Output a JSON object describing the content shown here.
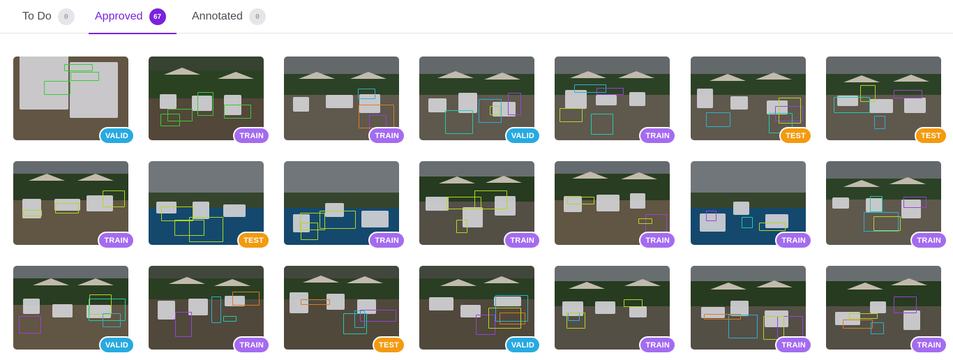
{
  "tabs": [
    {
      "label": "To Do",
      "count": "0",
      "active": false
    },
    {
      "label": "Approved",
      "count": "67",
      "active": true
    },
    {
      "label": "Annotated",
      "count": "0",
      "active": false
    }
  ],
  "split_colors": {
    "VALID": "#27aae1",
    "TRAIN": "#a46bf0",
    "TEST": "#f39a0f"
  },
  "box_colors": {
    "green": "#3ee53e",
    "lime": "#c9f026",
    "cyan": "#35c4e8",
    "purple": "#a84cf0",
    "orange": "#f28c28",
    "teal": "#28e3c0"
  },
  "images": [
    {
      "split": "VALID",
      "scene": "closeup",
      "boxes": [
        "green",
        "green",
        "green"
      ]
    },
    {
      "split": "TRAIN",
      "scene": "chairs",
      "boxes": [
        "green",
        "green",
        "green",
        "green"
      ]
    },
    {
      "split": "TRAIN",
      "scene": "patio",
      "boxes": [
        "cyan",
        "purple",
        "orange"
      ]
    },
    {
      "split": "VALID",
      "scene": "patio",
      "boxes": [
        "cyan",
        "purple",
        "lime",
        "teal"
      ]
    },
    {
      "split": "TRAIN",
      "scene": "patio",
      "boxes": [
        "cyan",
        "purple",
        "lime",
        "teal"
      ]
    },
    {
      "split": "TEST",
      "scene": "patio",
      "boxes": [
        "cyan",
        "purple",
        "lime",
        "teal"
      ]
    },
    {
      "split": "TEST",
      "scene": "patio",
      "boxes": [
        "cyan",
        "purple",
        "lime",
        "teal"
      ]
    },
    {
      "split": "TRAIN",
      "scene": "row",
      "boxes": [
        "lime",
        "lime",
        "lime"
      ]
    },
    {
      "split": "TEST",
      "scene": "pool",
      "boxes": [
        "lime",
        "lime",
        "lime"
      ]
    },
    {
      "split": "TRAIN",
      "scene": "pool",
      "boxes": [
        "lime",
        "lime",
        "lime"
      ]
    },
    {
      "split": "TRAIN",
      "scene": "lawn",
      "boxes": [
        "lime",
        "lime",
        "lime"
      ]
    },
    {
      "split": "TRAIN",
      "scene": "row",
      "boxes": [
        "lime",
        "purple",
        "lime"
      ]
    },
    {
      "split": "TRAIN",
      "scene": "pool",
      "boxes": [
        "lime",
        "purple",
        "teal"
      ]
    },
    {
      "split": "TRAIN",
      "scene": "patio",
      "boxes": [
        "cyan",
        "purple",
        "lime",
        "teal"
      ]
    },
    {
      "split": "VALID",
      "scene": "row",
      "boxes": [
        "purple",
        "lime",
        "teal",
        "cyan"
      ]
    },
    {
      "split": "TRAIN",
      "scene": "people",
      "boxes": [
        "cyan",
        "purple",
        "orange",
        "teal"
      ]
    },
    {
      "split": "TEST",
      "scene": "people",
      "boxes": [
        "cyan",
        "purple",
        "orange",
        "teal"
      ]
    },
    {
      "split": "VALID",
      "scene": "people",
      "boxes": [
        "cyan",
        "purple",
        "orange",
        "lime"
      ]
    },
    {
      "split": "TRAIN",
      "scene": "lawn",
      "boxes": [
        "lime",
        "cyan",
        "lime"
      ]
    },
    {
      "split": "TRAIN",
      "scene": "lawn",
      "boxes": [
        "cyan",
        "purple",
        "lime",
        "orange"
      ]
    },
    {
      "split": "TRAIN",
      "scene": "lawn",
      "boxes": [
        "purple",
        "orange",
        "lime",
        "cyan"
      ]
    }
  ]
}
